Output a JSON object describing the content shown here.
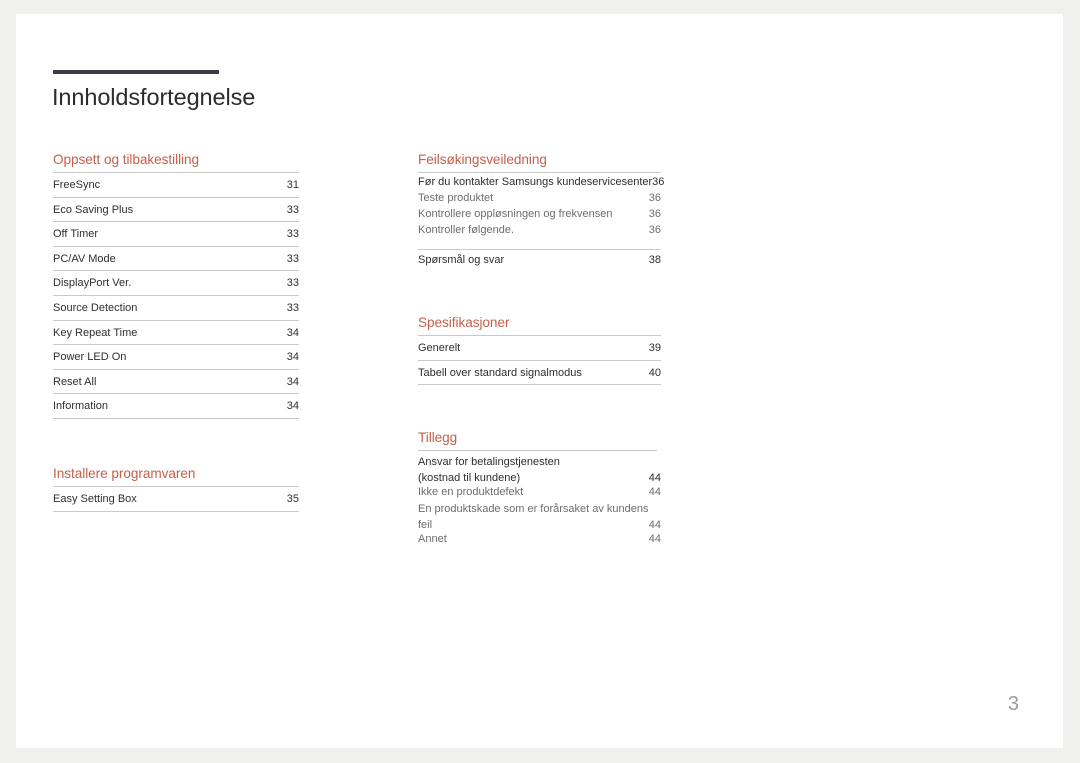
{
  "document": {
    "title": "Innholdsfortegnelse",
    "folio": "3",
    "accent_color": "#c4604a",
    "rule_color": "#3c3c46"
  },
  "left_column": {
    "sections": [
      {
        "heading": "Oppsett og tilbakestilling",
        "entries": [
          {
            "label": "FreeSync",
            "page": "31"
          },
          {
            "label": "Eco Saving Plus",
            "page": "33"
          },
          {
            "label": "Off Timer",
            "page": "33"
          },
          {
            "label": "PC/AV Mode",
            "page": "33"
          },
          {
            "label": "DisplayPort Ver.",
            "page": "33"
          },
          {
            "label": "Source Detection",
            "page": "33"
          },
          {
            "label": "Key Repeat Time",
            "page": "34"
          },
          {
            "label": "Power LED On",
            "page": "34"
          },
          {
            "label": "Reset All",
            "page": "34"
          },
          {
            "label": "Information",
            "page": "34"
          }
        ]
      },
      {
        "heading": "Installere programvaren",
        "entries": [
          {
            "label": "Easy Setting Box",
            "page": "35"
          }
        ]
      }
    ]
  },
  "right_column": {
    "sections": [
      {
        "heading": "Feilsøkingsveiledning",
        "entries": [
          {
            "label": "Før du kontakter Samsungs kundeservicesenter",
            "page": "36"
          },
          {
            "label": "Teste produktet",
            "page": "36"
          },
          {
            "label": "Kontrollere oppløsningen og frekvensen",
            "page": "36"
          },
          {
            "label": "Kontroller følgende.",
            "page": "36"
          },
          {
            "label": "Spørsmål og svar",
            "page": "38"
          }
        ]
      },
      {
        "heading": "Spesifikasjoner",
        "entries": [
          {
            "label": "Generelt",
            "page": "39"
          },
          {
            "label": "Tabell over standard signalmodus",
            "page": "40"
          }
        ]
      },
      {
        "heading": "Tillegg",
        "entries": [
          {
            "label_line1": "Ansvar for betalingstjenesten",
            "label_line2": "(kostnad til kundene)",
            "page": "44"
          },
          {
            "label": "Ikke en produktdefekt",
            "page": "44"
          },
          {
            "label_line1": "En produktskade som er forårsaket av kundens",
            "label_line2": "feil",
            "page": "44"
          },
          {
            "label": "Annet",
            "page": "44"
          }
        ]
      }
    ]
  }
}
